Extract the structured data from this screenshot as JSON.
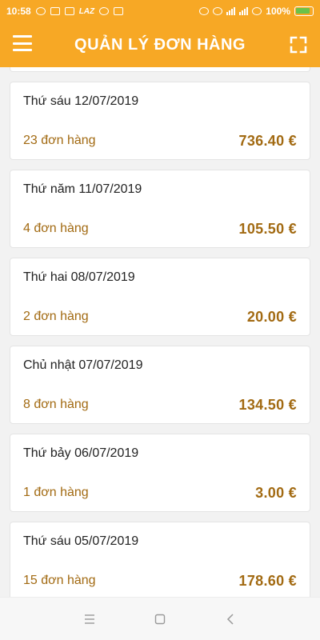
{
  "status_bar": {
    "time": "10:58",
    "carrier_badge": "LAZ",
    "battery_percent": "100%"
  },
  "header": {
    "title": "QUẢN LÝ ĐƠN HÀNG"
  },
  "orders": [
    {
      "date": "Thứ sáu 12/07/2019",
      "count": "23 đơn hàng",
      "total": "736.40 €"
    },
    {
      "date": "Thứ năm 11/07/2019",
      "count": "4 đơn hàng",
      "total": "105.50 €"
    },
    {
      "date": "Thứ hai 08/07/2019",
      "count": "2 đơn hàng",
      "total": "20.00 €"
    },
    {
      "date": "Chủ nhật 07/07/2019",
      "count": "8 đơn hàng",
      "total": "134.50 €"
    },
    {
      "date": "Thứ bảy 06/07/2019",
      "count": "1 đơn hàng",
      "total": "3.00 €"
    },
    {
      "date": "Thứ sáu 05/07/2019",
      "count": "15 đơn hàng",
      "total": "178.60 €"
    }
  ],
  "colors": {
    "primary": "#f7a825",
    "accent_text": "#a26a12",
    "battery_fill": "#6ac24a"
  },
  "icons": {
    "menu": "hamburger-icon",
    "fullscreen": "fullscreen-icon",
    "nav_recent": "recent-apps-icon",
    "nav_home": "home-icon",
    "nav_back": "back-icon"
  }
}
